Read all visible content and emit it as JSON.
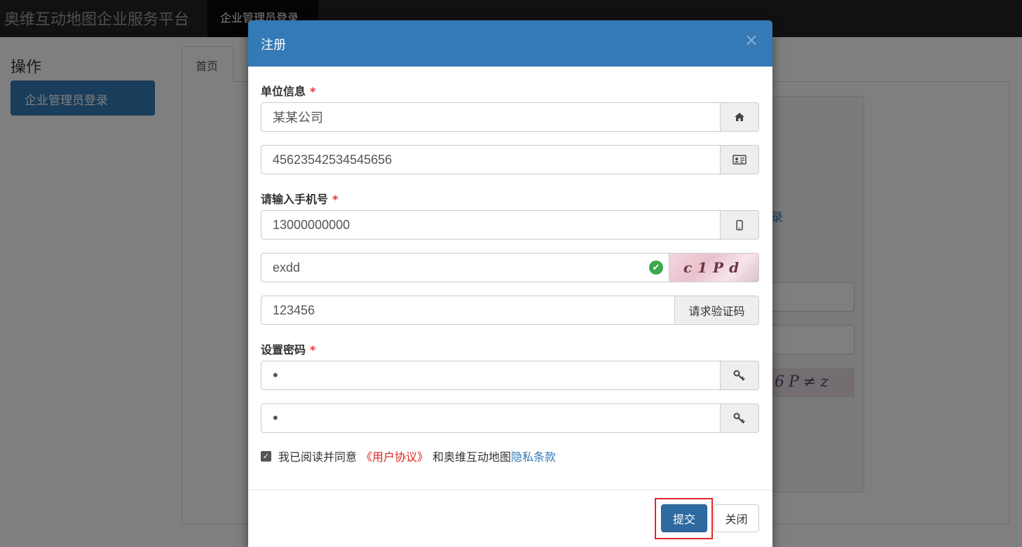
{
  "navbar": {
    "brand": "奥维互动地图企业服务平台",
    "active_item": "企业管理员登录"
  },
  "sidebar": {
    "title": "操作",
    "button_label": "企业管理员登录"
  },
  "tabs": [
    {
      "label": "首页"
    }
  ],
  "background": {
    "link_partial": "录",
    "captcha_text": "6P≠z"
  },
  "modal": {
    "title": "注册",
    "close_symbol": "×",
    "org_label": "单位信息",
    "required_mark": "*",
    "org_name_value": "某某公司",
    "org_code_value": "45623542534545656",
    "phone_label": "请输入手机号",
    "phone_value": "13000000000",
    "captcha_value": "exdd",
    "captcha_image_text": "c1Pd",
    "sms_code_value": "123456",
    "sms_button_label": "请求验证码",
    "password_label": "设置密码",
    "password_value": "•",
    "password_confirm_value": "•",
    "agree_prefix": "我已阅读并同意",
    "agree_user_link": "《用户协议》",
    "agree_middle": "和奥维互动地图",
    "agree_privacy_link": "隐私条款",
    "submit_label": "提交",
    "close_label": "关闭"
  },
  "icons": {
    "home": "home-icon",
    "id_card": "id-card-icon",
    "phone": "mobile-phone-icon",
    "key": "key-icon",
    "check": "check-circle-icon",
    "checkbox": "checkbox-checked-icon"
  },
  "colors": {
    "primary": "#337ab7",
    "navbar": "#222222",
    "required": "#ee3333",
    "highlight": "#e0262d",
    "success": "#3aa94a"
  }
}
